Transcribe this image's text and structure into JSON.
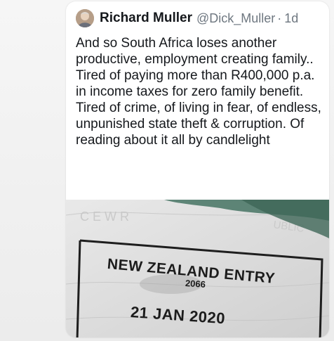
{
  "tweet": {
    "author_name": "Richard Muller",
    "handle": "@Dick_Muller",
    "separator": "·",
    "time": "1d",
    "text": "And so South Africa loses another productive, employment creating family..\nTired of paying more than R400,000 p.a. in income taxes for zero family benefit. Tired of  crime, of living in fear, of endless, unpunished state theft & corruption. Of reading about it all by candlelight"
  },
  "photo": {
    "stamp_title": "NEW ZEALAND ENTRY",
    "stamp_code": "2066",
    "stamp_date": "21 JAN 2020"
  },
  "colors": {
    "card_background": "#ffffff",
    "text_primary": "#15181c",
    "text_secondary": "#6e7780",
    "photo_stain": "#4f7a6a"
  }
}
